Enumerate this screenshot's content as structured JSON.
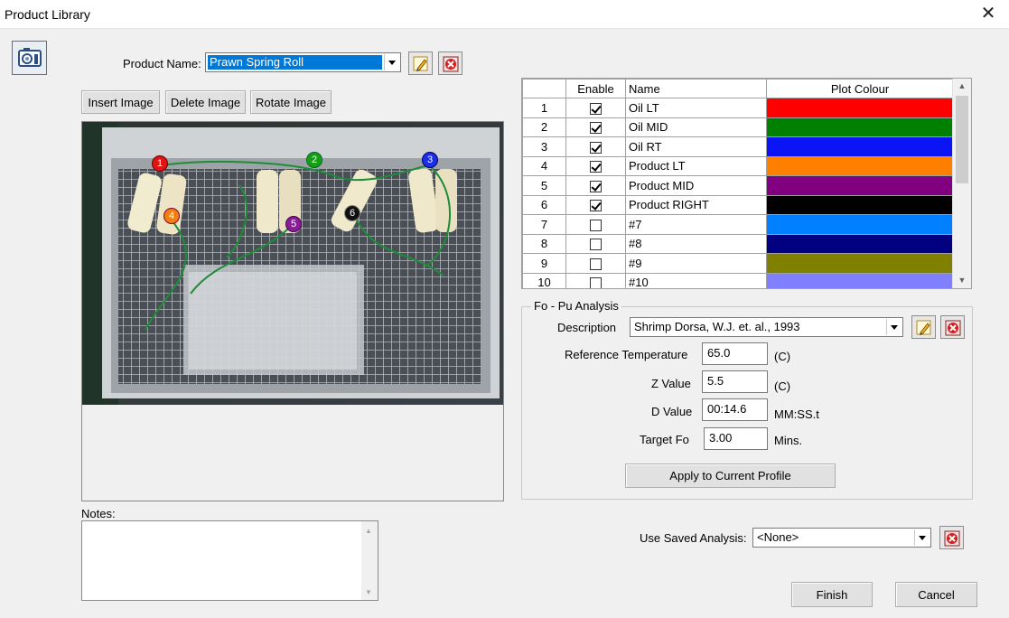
{
  "window": {
    "title": "Product Library",
    "close_glyph": "✕"
  },
  "product": {
    "label": "Product Name:",
    "value": "Prawn Spring Roll"
  },
  "image_toolbar": {
    "insert_label": "Insert Image",
    "delete_label": "Delete Image",
    "rotate_label": "Rotate Image"
  },
  "probe_markers": [
    {
      "label": "1",
      "color": "#e11414"
    },
    {
      "label": "2",
      "color": "#13a012"
    },
    {
      "label": "3",
      "color": "#1c2fe8"
    },
    {
      "label": "4",
      "color": "#f07f10"
    },
    {
      "label": "5",
      "color": "#8a1c9a"
    },
    {
      "label": "6",
      "color": "#111111"
    }
  ],
  "grid": {
    "headers": [
      "",
      "Enable",
      "Name",
      "Plot Colour"
    ],
    "rows": [
      {
        "num": "1",
        "enabled": true,
        "name": "Oil LT",
        "color": "#ff0000"
      },
      {
        "num": "2",
        "enabled": true,
        "name": "Oil MID",
        "color": "#008000"
      },
      {
        "num": "3",
        "enabled": true,
        "name": "Oil RT",
        "color": "#0a14f5"
      },
      {
        "num": "4",
        "enabled": true,
        "name": "Product LT",
        "color": "#ff8000"
      },
      {
        "num": "5",
        "enabled": true,
        "name": "Product MID",
        "color": "#800080"
      },
      {
        "num": "6",
        "enabled": true,
        "name": "Product RIGHT",
        "color": "#000000"
      },
      {
        "num": "7",
        "enabled": false,
        "name": "#7",
        "color": "#0080ff"
      },
      {
        "num": "8",
        "enabled": false,
        "name": "#8",
        "color": "#000080"
      },
      {
        "num": "9",
        "enabled": false,
        "name": "#9",
        "color": "#808000"
      },
      {
        "num": "10",
        "enabled": false,
        "name": "#10",
        "color": "#8080ff"
      }
    ]
  },
  "analysis": {
    "group_label": "Fo - Pu Analysis",
    "description_label": "Description",
    "description_value": "Shrimp Dorsa, W.J. et. al., 1993",
    "ref_temp_label": "Reference Temperature",
    "ref_temp_value": "65.0",
    "ref_temp_unit": "(C)",
    "z_label": "Z Value",
    "z_value": "5.5",
    "z_unit": "(C)",
    "d_label": "D Value",
    "d_value": "00:14.6",
    "d_unit": "MM:SS.t",
    "target_label": "Target Fo",
    "target_value": "3.00",
    "target_unit": "Mins.",
    "apply_label": "Apply to Current Profile"
  },
  "notes": {
    "label": "Notes:",
    "value": ""
  },
  "saved": {
    "label": "Use Saved Analysis:",
    "value": "<None>"
  },
  "footer": {
    "finish_label": "Finish",
    "cancel_label": "Cancel"
  }
}
